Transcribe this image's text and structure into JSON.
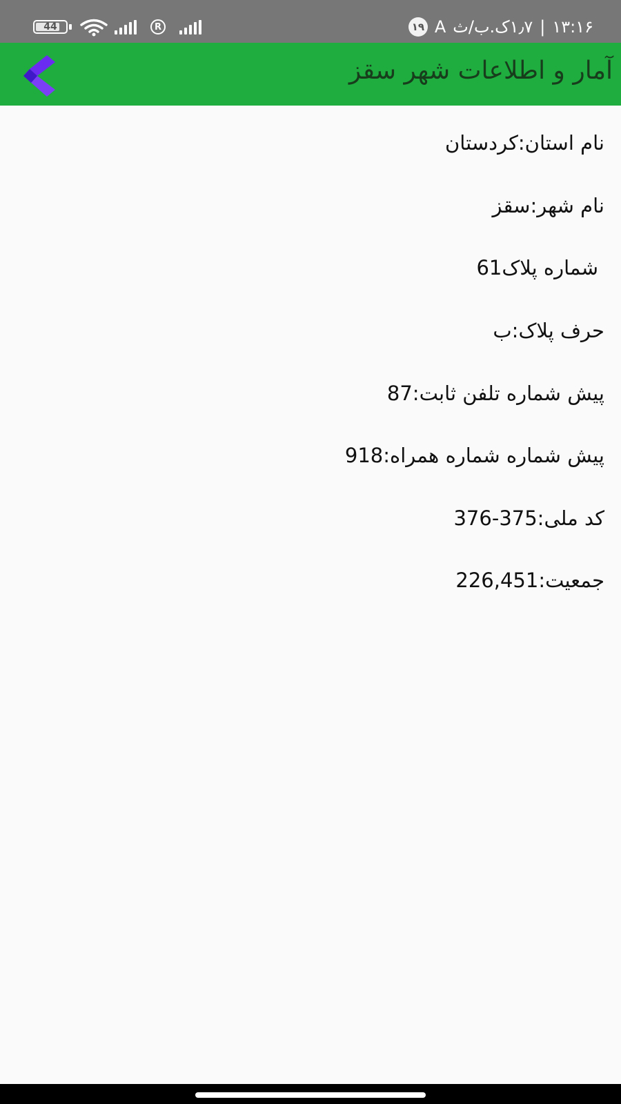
{
  "status_bar": {
    "battery_level": "44",
    "registered_icon": "R",
    "notification_count": "۱۹",
    "network_text": "A",
    "speed_text": "۱٫۷ک.ب/ث",
    "separator": "|",
    "time": "۱۳:۱۶"
  },
  "app_bar": {
    "title": "آمار و اطلاعات شهر سقز",
    "back_icon": "chevron-left-icon",
    "background_color": "#1fad40",
    "back_icon_color": "#6a2cf0"
  },
  "info": {
    "province": "نام استان:کردستان",
    "city": "نام شهر:سقز",
    "plate_number": "شماره پلاک61",
    "plate_letter": "حرف پلاک:ب",
    "landline_prefix": "پیش شماره تلفن ثابت:87",
    "mobile_prefix": "پیش شماره شماره همراه:918",
    "national_code": "کد ملی:375-376",
    "population": "جمعیت:226,451"
  }
}
